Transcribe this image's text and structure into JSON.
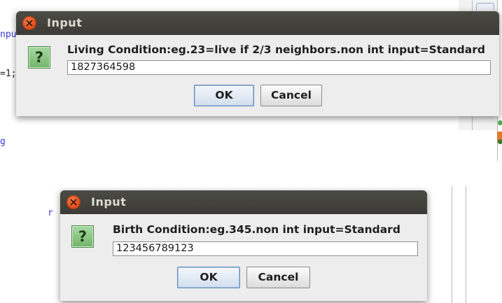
{
  "colors": {
    "titlebar": "#3c3b37",
    "close_button": "#dd4814",
    "dialog_bg": "#ededed",
    "question_icon": "#72b56a"
  },
  "background": {
    "fragment_1": "npu",
    "fragment_2": "=1;",
    "fragment_3": "g",
    "fragment_4": "r"
  },
  "dialogs": [
    {
      "title": "Input",
      "close_icon": "close-icon",
      "icon": "question-icon",
      "icon_glyph": "?",
      "prompt": "Living Condition:eg.23=live if 2/3 neighbors.non int input=Standard",
      "value": "1827364598",
      "ok_label": "OK",
      "cancel_label": "Cancel"
    },
    {
      "title": "Input",
      "close_icon": "close-icon",
      "icon": "question-icon",
      "icon_glyph": "?",
      "prompt": "Birth Condition:eg.345.non int input=Standard",
      "value": "123456789123",
      "ok_label": "OK",
      "cancel_label": "Cancel"
    }
  ]
}
